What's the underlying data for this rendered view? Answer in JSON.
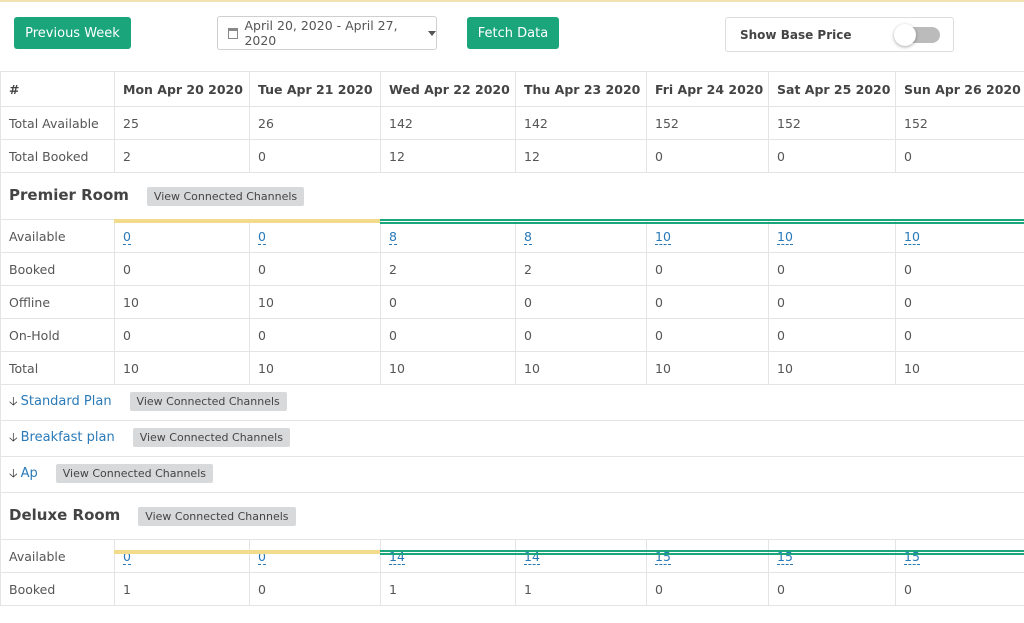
{
  "toolbar": {
    "prev_label": "Previous Week",
    "date_range": "April 20, 2020 - April 27, 2020",
    "fetch_label": "Fetch Data",
    "base_price_label": "Show Base Price"
  },
  "table": {
    "hash": "#",
    "days": [
      "Mon Apr 20 2020",
      "Tue Apr 21 2020",
      "Wed Apr 22 2020",
      "Thu Apr 23 2020",
      "Fri Apr 24 2020",
      "Sat Apr 25 2020",
      "Sun Apr 26 2020"
    ],
    "summary": [
      {
        "label": "Total Available",
        "values": [
          "25",
          "26",
          "142",
          "142",
          "152",
          "152",
          "152"
        ]
      },
      {
        "label": "Total Booked",
        "values": [
          "2",
          "0",
          "12",
          "12",
          "0",
          "0",
          "0"
        ]
      }
    ],
    "view_channels": "View Connected Channels",
    "rooms": [
      {
        "name": "Premier Room",
        "rows": [
          {
            "label": "Available",
            "values": [
              "0",
              "0",
              "8",
              "8",
              "10",
              "10",
              "10"
            ]
          },
          {
            "label": "Booked",
            "values": [
              "0",
              "0",
              "2",
              "2",
              "0",
              "0",
              "0"
            ]
          },
          {
            "label": "Offline",
            "values": [
              "10",
              "10",
              "0",
              "0",
              "0",
              "0",
              "0"
            ]
          },
          {
            "label": "On-Hold",
            "values": [
              "0",
              "0",
              "0",
              "0",
              "0",
              "0",
              "0"
            ]
          },
          {
            "label": "Total",
            "values": [
              "10",
              "10",
              "10",
              "10",
              "10",
              "10",
              "10"
            ]
          }
        ],
        "plans": [
          "Standard Plan",
          "Breakfast plan",
          "Ap"
        ]
      },
      {
        "name": "Deluxe Room",
        "rows": [
          {
            "label": "Available",
            "values": [
              "0",
              "0",
              "14",
              "14",
              "15",
              "15",
              "15"
            ]
          },
          {
            "label": "Booked",
            "values": [
              "1",
              "0",
              "1",
              "1",
              "0",
              "0",
              "0"
            ]
          }
        ]
      }
    ]
  },
  "colors": {
    "green": "#1aa57a",
    "yellow": "#f2dc8c",
    "link": "#2a7ab8"
  }
}
